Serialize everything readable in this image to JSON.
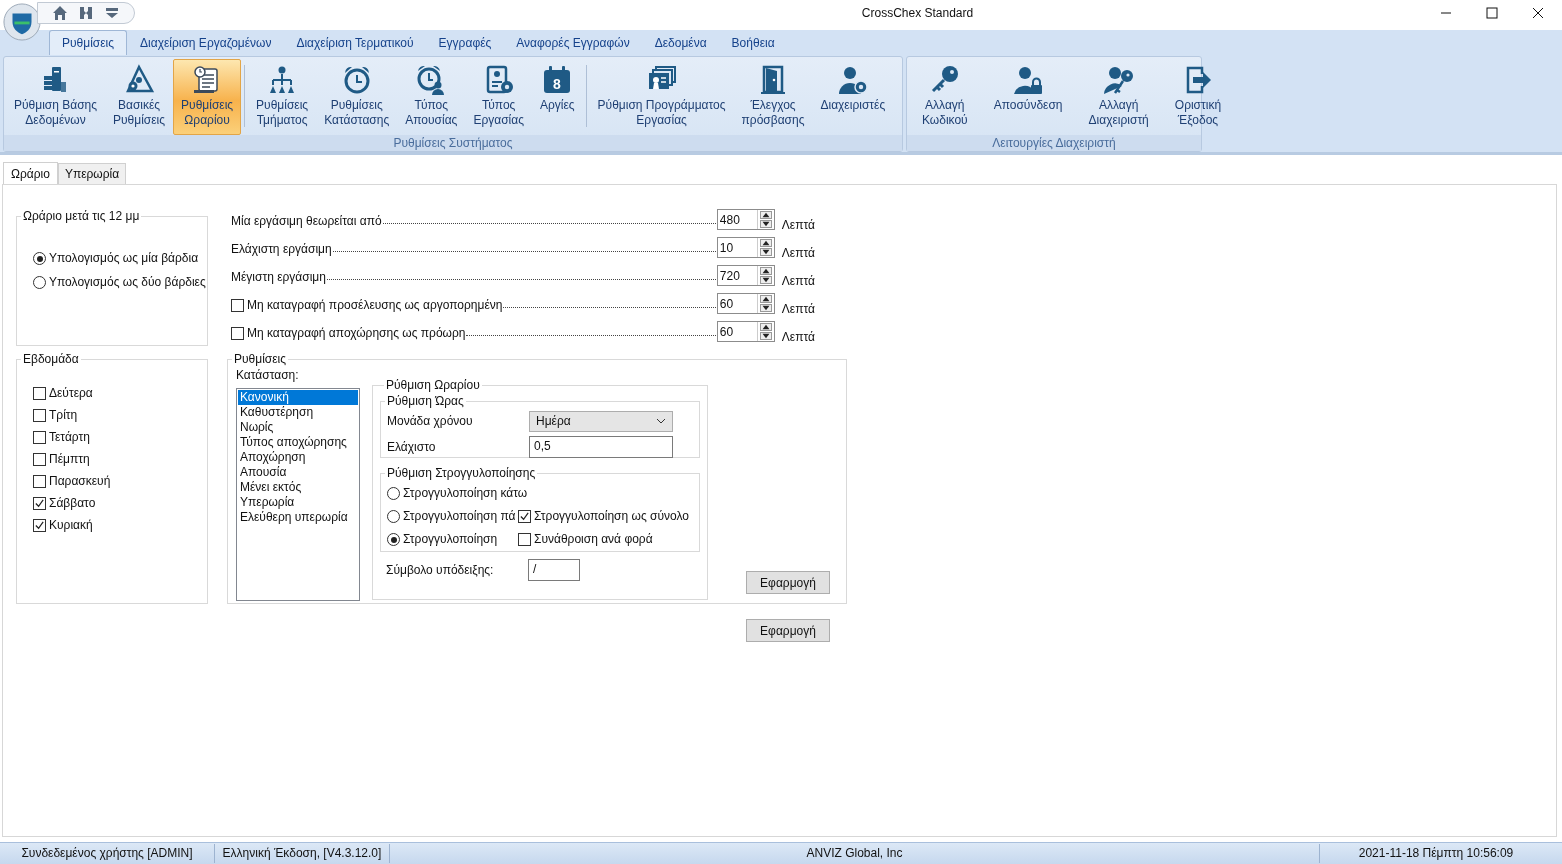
{
  "window": {
    "title": "CrossChex Standard"
  },
  "ribbon_tabs": [
    {
      "label": "Ρυθμίσεις",
      "selected": true
    },
    {
      "label": "Διαχείριση Εργαζομένων",
      "selected": false
    },
    {
      "label": "Διαχείριση Τερματικού",
      "selected": false
    },
    {
      "label": "Εγγραφές",
      "selected": false
    },
    {
      "label": "Αναφορές Εγγραφών",
      "selected": false
    },
    {
      "label": "Δεδομένα",
      "selected": false
    },
    {
      "label": "Βοήθεια",
      "selected": false
    }
  ],
  "ribbon_groups": [
    {
      "title": "Ρυθμίσεις Συστήματος",
      "sections": [
        [
          {
            "kind": "server",
            "label": "Ρύθμιση Βάσης\nΔεδομένων",
            "selected": false
          },
          {
            "kind": "triangle",
            "label": "Βασικές\nΡυθμίσεις",
            "selected": false
          },
          {
            "kind": "schedule",
            "label": "Ρυθμίσεις\nΩραρίου",
            "selected": true
          }
        ],
        [
          {
            "kind": "org",
            "label": "Ρυθμίσεις\nΤμήματος",
            "selected": false
          },
          {
            "kind": "alarm",
            "label": "Ρυθμίσεις\nΚατάστασης",
            "selected": false
          },
          {
            "kind": "alarmperson",
            "label": "Τύπος\nΑπουσίας",
            "selected": false
          },
          {
            "kind": "badge",
            "label": "Τύπος\nΕργασίας",
            "selected": false
          },
          {
            "kind": "calendar",
            "label": "Αργίες",
            "icon_text": "8",
            "selected": false
          }
        ],
        [
          {
            "kind": "cards",
            "label": "Ρύθμιση Προγράμματος\nΕργασίας",
            "selected": false
          },
          {
            "kind": "door",
            "label": "Έλεγχος\nπρόσβασης",
            "selected": false
          },
          {
            "kind": "usergear",
            "label": "Διαχειριστές",
            "selected": false
          }
        ]
      ]
    },
    {
      "title": "Λειτουργίες Διαχειριστή",
      "sections": [
        [
          {
            "kind": "key",
            "label": "Αλλαγή\nΚωδικού",
            "selected": false
          },
          {
            "kind": "userlock",
            "label": "Αποσύνδεση",
            "selected": false
          },
          {
            "kind": "userkey",
            "label": "Αλλαγή\nΔιαχειριστή",
            "selected": false
          },
          {
            "kind": "exit",
            "label": "Οριστική\nΈξοδος",
            "selected": false
          }
        ]
      ]
    }
  ],
  "content_tabs": [
    {
      "label": "Ωράριο",
      "selected": true
    },
    {
      "label": "Υπερωρία",
      "selected": false
    }
  ],
  "shift_group": {
    "title": "Ωράριο μετά τις 12 μμ",
    "options": [
      {
        "label": "Υπολογισμός ως μία βάρδια",
        "selected": true
      },
      {
        "label": "Υπολογισμός ως δύο βάρδιες",
        "selected": false
      }
    ]
  },
  "week_group": {
    "title": "Εβδομάδα",
    "days": [
      {
        "label": "Δεύτερα",
        "checked": false
      },
      {
        "label": "Τρίτη",
        "checked": false
      },
      {
        "label": "Τετάρτη",
        "checked": false
      },
      {
        "label": "Πέμπτη",
        "checked": false
      },
      {
        "label": "Παρασκευή",
        "checked": false
      },
      {
        "label": "Σάββατο",
        "checked": true
      },
      {
        "label": "Κυριακή",
        "checked": true
      }
    ]
  },
  "duration_rows": [
    {
      "kind": "plain",
      "label": "Μία εργάσιμη θεωρείται από",
      "value": "480",
      "unit": "Λεπτά"
    },
    {
      "kind": "plain",
      "label": "Ελάχιστη εργάσιμη",
      "value": "10",
      "unit": "Λεπτά"
    },
    {
      "kind": "plain",
      "label": "Μέγιστη εργάσιμη",
      "value": "720",
      "unit": "Λεπτά"
    },
    {
      "kind": "checkbox",
      "label": "Μη καταγραφή προσέλευσης ως αργοπορημένη",
      "checked": false,
      "value": "60",
      "unit": "Λεπτά"
    },
    {
      "kind": "checkbox",
      "label": "Μη καταγραφή αποχώρησης ως πρόωρη",
      "checked": false,
      "value": "60",
      "unit": "Λεπτά"
    }
  ],
  "settings": {
    "title": "Ρυθμίσεις",
    "status_label": "Κατάσταση:",
    "status_list": [
      {
        "label": "Κανονική",
        "selected": true
      },
      {
        "label": "Καθυστέρηση",
        "selected": false
      },
      {
        "label": "Νωρίς",
        "selected": false
      },
      {
        "label": "Τύπος αποχώρησης",
        "selected": false
      },
      {
        "label": "Αποχώρηση",
        "selected": false
      },
      {
        "label": "Απουσία",
        "selected": false
      },
      {
        "label": "Μένει εκτός",
        "selected": false
      },
      {
        "label": "Υπερωρία",
        "selected": false
      },
      {
        "label": "Ελεύθερη υπερωρία",
        "selected": false
      }
    ],
    "schedule": {
      "title": "Ρύθμιση Ωραρίου",
      "time": {
        "title": "Ρύθμιση Ώρας",
        "unit_label": "Μονάδα χρόνου",
        "unit_value": "Ημέρα",
        "min_label": "Ελάχιστο",
        "min_value": "0,5"
      },
      "rounding": {
        "title": "Ρύθμιση Στρογγυλοποίησης",
        "options": [
          {
            "label": "Στρογγυλοποίηση κάτω",
            "selected": false
          },
          {
            "label": "Στρογγυλοποίηση πά",
            "selected": false
          },
          {
            "label": "Στρογγυλοποίηση",
            "selected": true
          }
        ],
        "checks": [
          {
            "label": "Στρογγυλοποίηση ως σύνολο",
            "checked": true
          },
          {
            "label": "Συνάθροιση ανά φορά",
            "checked": false
          }
        ]
      },
      "symbol_label": "Σύμβολο υπόδειξης:",
      "symbol_value": "/"
    },
    "apply": "Εφαρμογή"
  },
  "apply": "Εφαρμογή",
  "status_bar": [
    "Συνδεδεμένος χρήστης [ADMIN]",
    "Ελληνική Έκδοση, [V4.3.12.0]",
    "ANVIZ Global, Inc",
    "2021-11-18 Πέμπτη 10:56:09"
  ]
}
